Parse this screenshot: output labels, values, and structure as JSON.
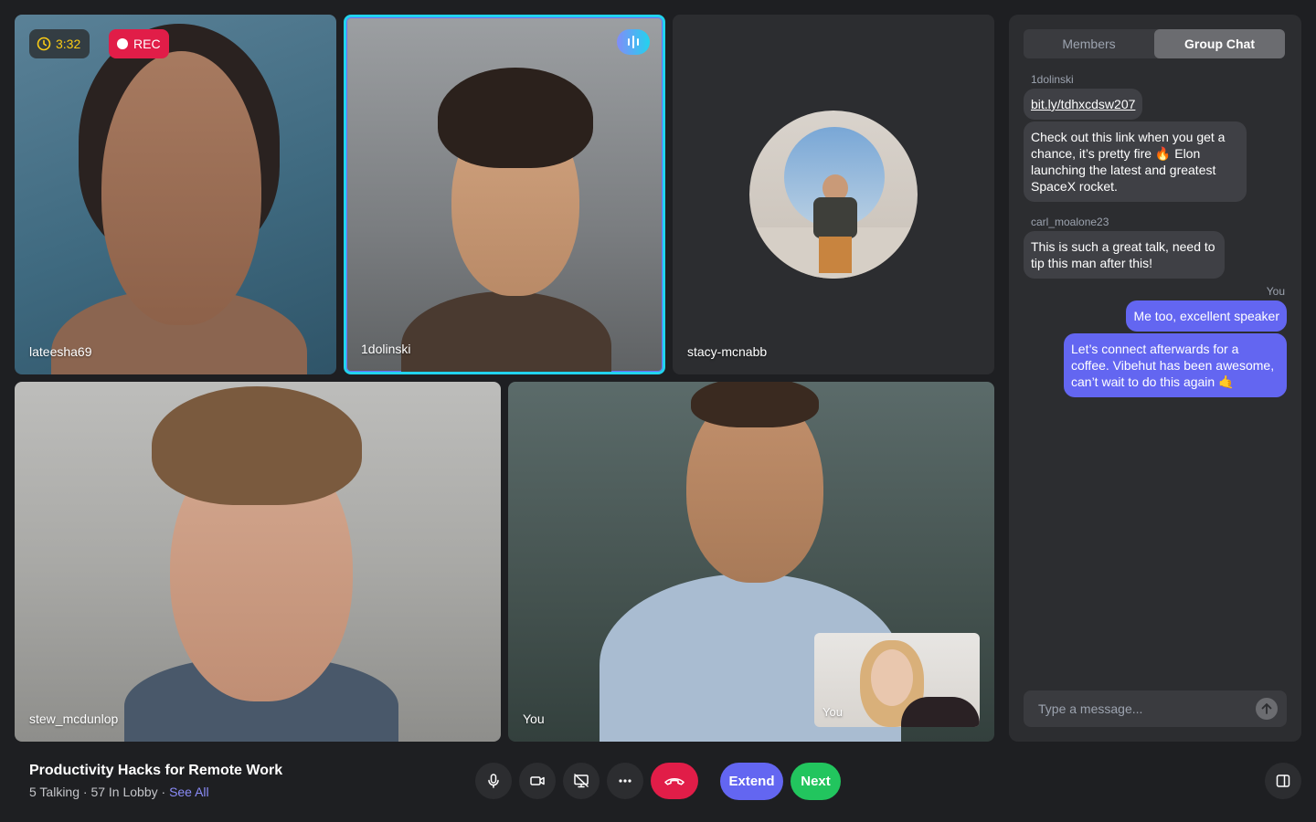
{
  "tiles": [
    {
      "name": "lateesha69"
    },
    {
      "name": "1dolinski"
    },
    {
      "name": "stacy-mcnabb"
    },
    {
      "name": "stew_mcdunlop"
    },
    {
      "name": "You"
    }
  ],
  "pip": {
    "name": "You"
  },
  "call": {
    "timer": "3:32",
    "rec_label": "REC"
  },
  "chat": {
    "tabs": [
      {
        "label": "Members",
        "active": false
      },
      {
        "label": "Group Chat",
        "active": true
      }
    ],
    "messages": [
      {
        "author": "1dolinski",
        "text": "bit.ly/tdhxcdsw207"
      },
      {
        "author": "",
        "text": "Check out this link when you get a chance, it’s pretty fire 🔥 Elon launching the latest and greatest SpaceX rocket."
      },
      {
        "author": "carl_moalone23",
        "text": "This is such a great talk, need to tip this man after this!"
      },
      {
        "author": "You",
        "text": "Me too, excellent speaker"
      },
      {
        "author": "",
        "text": "Let’s connect afterwards for a coffee. Vibehut has been awesome, can’t wait to do this again 🤙"
      }
    ],
    "input_placeholder": "Type a message..."
  },
  "meeting": {
    "title": "Productivity Hacks for Remote Work",
    "stats": "5 Talking · 57 In Lobby · ",
    "see_all": "See All"
  },
  "controls": {
    "extend_label": "Extend",
    "next_label": "Next"
  },
  "colors": {
    "background": "#1e1f22",
    "panel": "#2c2d30",
    "accent": "#6366f1",
    "active_speaker_border": "#22d3ee",
    "record": "#e11d48",
    "timer": "#facc15",
    "next": "#22c55e"
  }
}
